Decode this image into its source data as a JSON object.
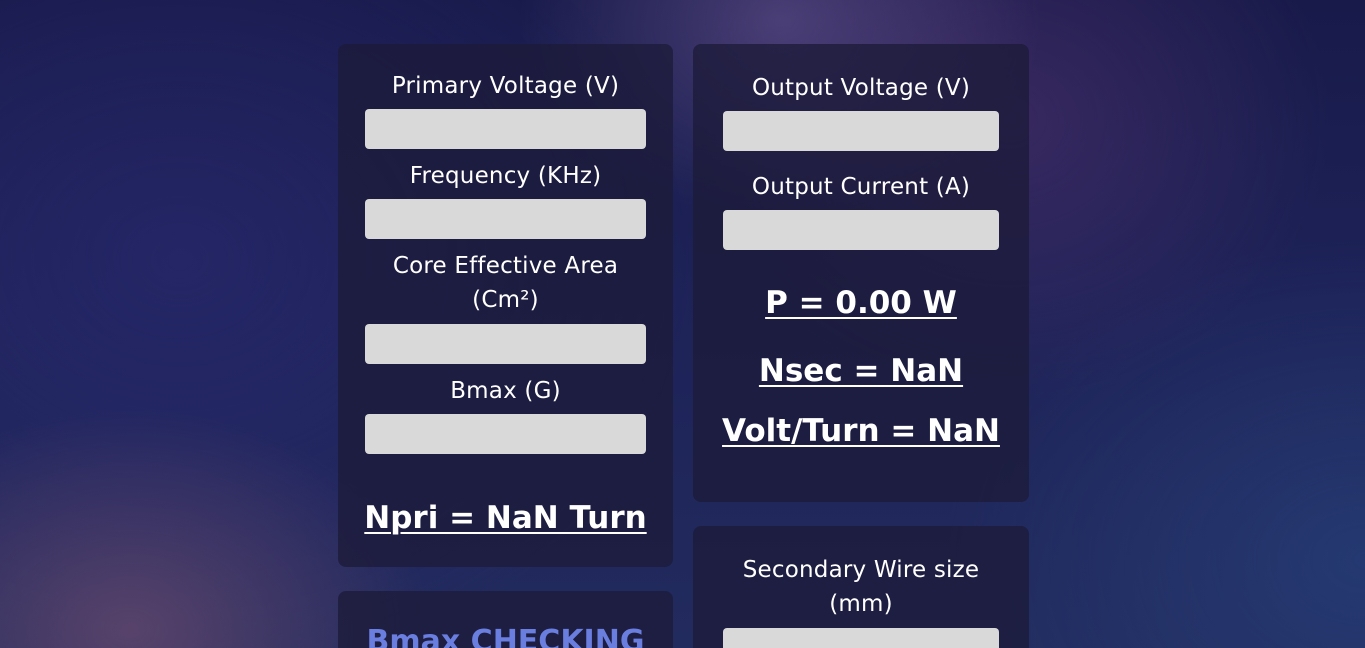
{
  "primary_card": {
    "primary_voltage_label": "Primary Voltage (V)",
    "primary_voltage_value": "",
    "frequency_label": "Frequency (KHz)",
    "frequency_value": "",
    "core_area_label_line1": "Core Effective Area",
    "core_area_label_line2": "(Cm²)",
    "core_area_value": "",
    "bmax_label": "Bmax (G)",
    "bmax_value": "",
    "npri_result": "Npri = NaN Turn"
  },
  "output_card": {
    "output_voltage_label": "Output Voltage (V)",
    "output_voltage_value": "",
    "output_current_label": "Output Current (A)",
    "output_current_value": "",
    "power_result": "P = 0.00 W",
    "nsec_result": "Nsec = NaN",
    "volt_turn_result": "Volt/Turn = NaN"
  },
  "bmax_check_card": {
    "heading": "Bmax CHECKING"
  },
  "wire_card": {
    "secondary_wire_label_line1": "Secondary Wire size",
    "secondary_wire_label_line2": "(mm)",
    "secondary_wire_value": ""
  },
  "colors": {
    "card_background": "#1c1b3a",
    "input_background": "#d9d9d9",
    "heading_accent": "#6a7ee0",
    "text": "#ffffff"
  }
}
